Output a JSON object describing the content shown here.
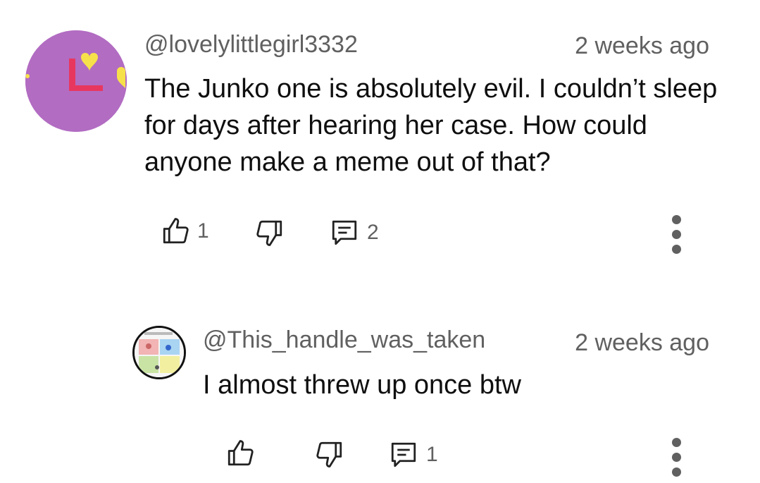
{
  "comments": [
    {
      "handle": "@lovelylittlegirl3332",
      "time": "2 weeks ago",
      "text": "The Junko one is absolutely evil. I couldn’t sleep for days after hearing her case. How could anyone make a meme out of that?",
      "likes": "1",
      "replies": "2"
    },
    {
      "handle": "@This_handle_was_taken",
      "time": "2 weeks ago",
      "text": "I almost threw up once btw",
      "replies": "1"
    }
  ],
  "icons": {
    "like": "thumbs-up-icon",
    "dislike": "thumbs-down-icon",
    "reply": "comment-icon",
    "more": "more-vertical-icon"
  },
  "colors": {
    "avatar1_bg": "#b26cc2",
    "secondary_text": "#606060"
  }
}
